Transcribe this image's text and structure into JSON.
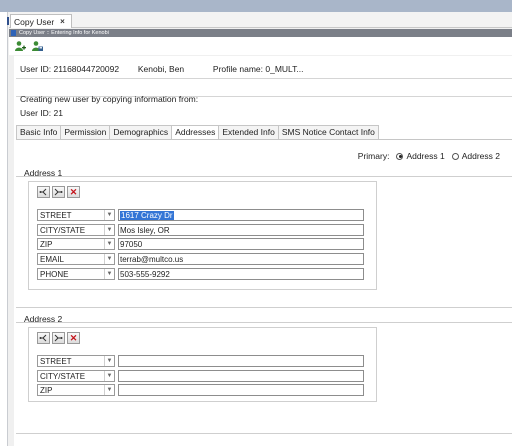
{
  "doc_tab": {
    "title": "Copy User",
    "close": "×"
  },
  "status_text": "Copy User :: Entering Info for Kenobi",
  "toolbar": {
    "icons": [
      "add-user-icon",
      "save-user-icon"
    ]
  },
  "user": {
    "id_label": "User ID: 21168044720092",
    "name": "Kenobi, Ben",
    "profile": "Profile name: 0_MULT..."
  },
  "creating_text": "Creating new user by copying information from:",
  "source_user": "User ID: 21",
  "tabs": [
    {
      "label": "Basic Info"
    },
    {
      "label": "Permission"
    },
    {
      "label": "Demographics"
    },
    {
      "label": "Addresses",
      "active": true
    },
    {
      "label": "Extended Info"
    },
    {
      "label": "SMS Notice Contact Info"
    }
  ],
  "primary": {
    "label": "Primary:",
    "option1": "Address 1",
    "option2": "Address 2",
    "selected": "Address 1"
  },
  "address1": {
    "label": "Address 1",
    "rows": [
      {
        "type": "STREET",
        "value": "1617 Crazy Dr"
      },
      {
        "type": "CITY/STATE",
        "value": "Mos Isley, OR"
      },
      {
        "type": "ZIP",
        "value": "97050"
      },
      {
        "type": "EMAIL",
        "value": "terrab@multco.us"
      },
      {
        "type": "PHONE",
        "value": "503-555-9292"
      }
    ]
  },
  "address2": {
    "label": "Address 2",
    "rows": [
      {
        "type": "STREET",
        "value": ""
      },
      {
        "type": "CITY/STATE",
        "value": ""
      },
      {
        "type": "ZIP",
        "value": ""
      }
    ]
  },
  "colors": {
    "accent": "#3375d6",
    "delete": "#c4121a",
    "status_bar": "#7b7f88"
  }
}
